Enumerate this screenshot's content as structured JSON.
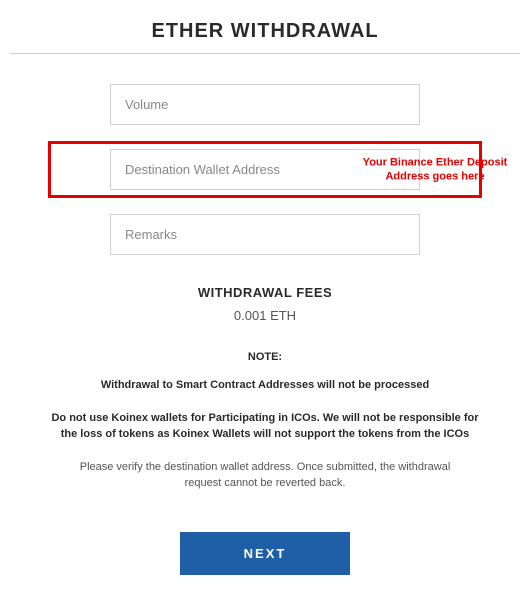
{
  "title": "ETHER WITHDRAWAL",
  "form": {
    "volume_placeholder": "Volume",
    "destination_placeholder": "Destination Wallet Address",
    "remarks_placeholder": "Remarks"
  },
  "annotation": {
    "destination_hint": "Your Binance Ether Deposit Address goes here"
  },
  "fees": {
    "heading": "WITHDRAWAL FEES",
    "value": "0.001 ETH"
  },
  "notes": {
    "heading": "NOTE:",
    "line1": "Withdrawal to Smart Contract Addresses will not be processed",
    "line2": "Do not use Koinex wallets for Participating in ICOs. We will not be responsible for the loss of tokens as Koinex Wallets will not support the tokens from the ICOs",
    "line3": "Please verify the destination wallet address. Once submitted, the withdrawal request cannot be reverted back."
  },
  "buttons": {
    "next": "NEXT"
  }
}
